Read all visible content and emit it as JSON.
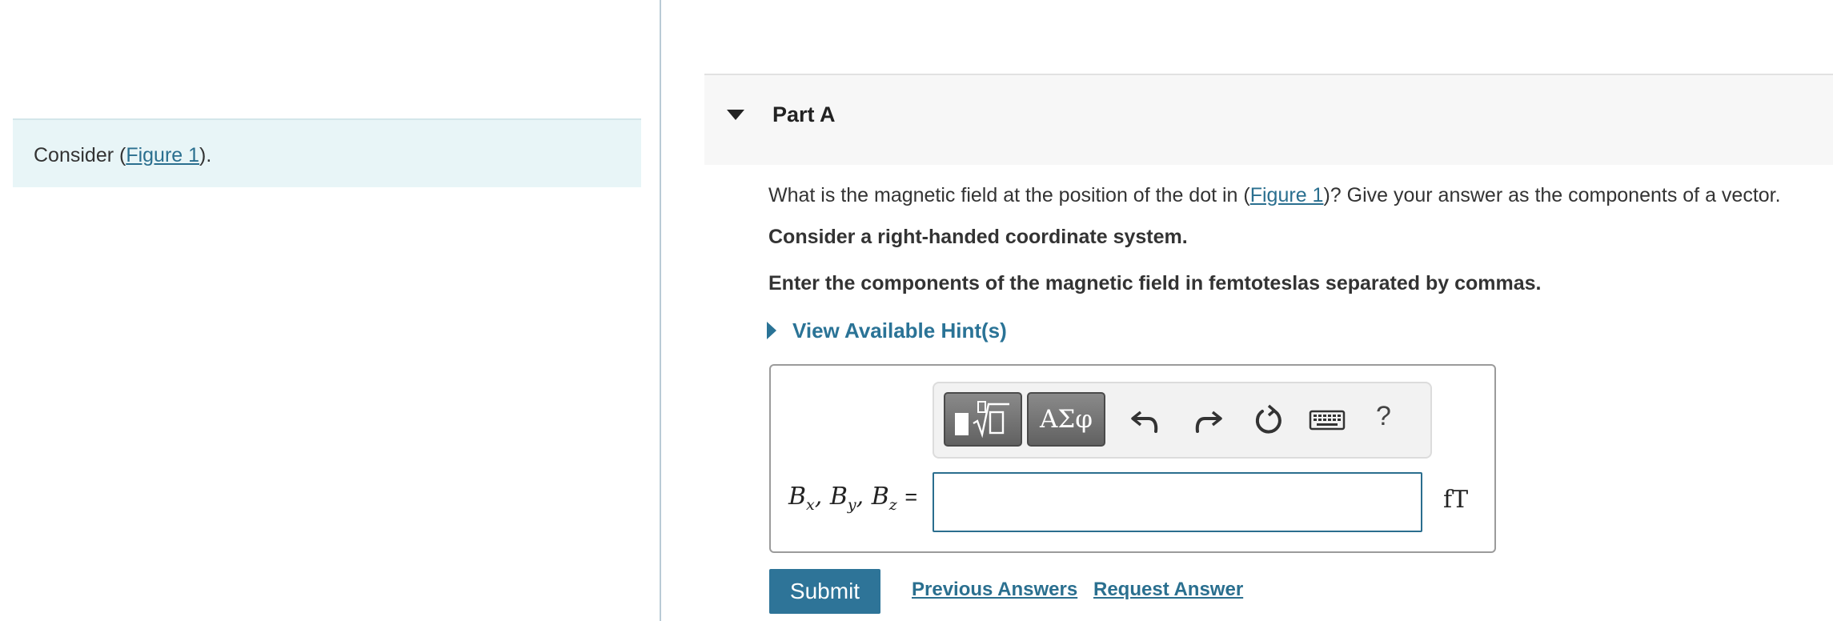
{
  "intro": {
    "prefix": "Consider (",
    "link": "Figure 1",
    "suffix": ")."
  },
  "part": {
    "title": "Part A"
  },
  "question": {
    "prefix": "What is the magnetic field at the position of the dot in (",
    "link": "Figure 1",
    "suffix": ")? Give your answer as the components of a vector.",
    "line2": "Consider a right-handed coordinate system.",
    "line3": "Enter the components of the magnetic field in femtoteslas separated by commas."
  },
  "hint": {
    "label": "View Available Hint(s)"
  },
  "toolbar": {
    "symbols_label": "ΑΣφ",
    "help_label": "?"
  },
  "answer": {
    "var1": "B",
    "sub1": "x",
    "var2": "B",
    "sub2": "y",
    "var3": "B",
    "sub3": "z",
    "equals": "=",
    "value": "",
    "unit": "fT"
  },
  "actions": {
    "submit": "Submit",
    "previous_answers": "Previous Answers",
    "request_answer": "Request Answer"
  },
  "colors": {
    "accent": "#2e7498",
    "link": "#2a6f8f",
    "intro_bg": "#e8f5f7"
  }
}
